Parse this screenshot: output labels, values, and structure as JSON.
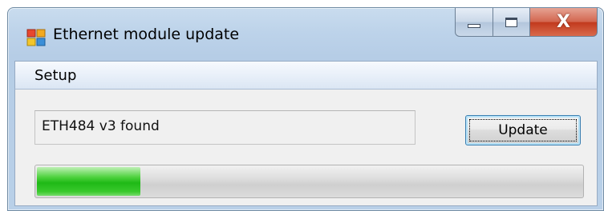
{
  "window": {
    "title": "Ethernet module update",
    "app_icon": "windows-form-icon",
    "caption_buttons": {
      "minimize_icon": "minimize-icon",
      "maximize_icon": "maximize-icon",
      "close_icon": "close-icon",
      "close_glyph": "X"
    }
  },
  "menu": {
    "items": [
      {
        "label": "Setup"
      }
    ]
  },
  "main": {
    "status_text": "ETH484 v3 found",
    "update_button_label": "Update",
    "progress_fraction": 0.19,
    "progress_color": "#1fb916"
  }
}
